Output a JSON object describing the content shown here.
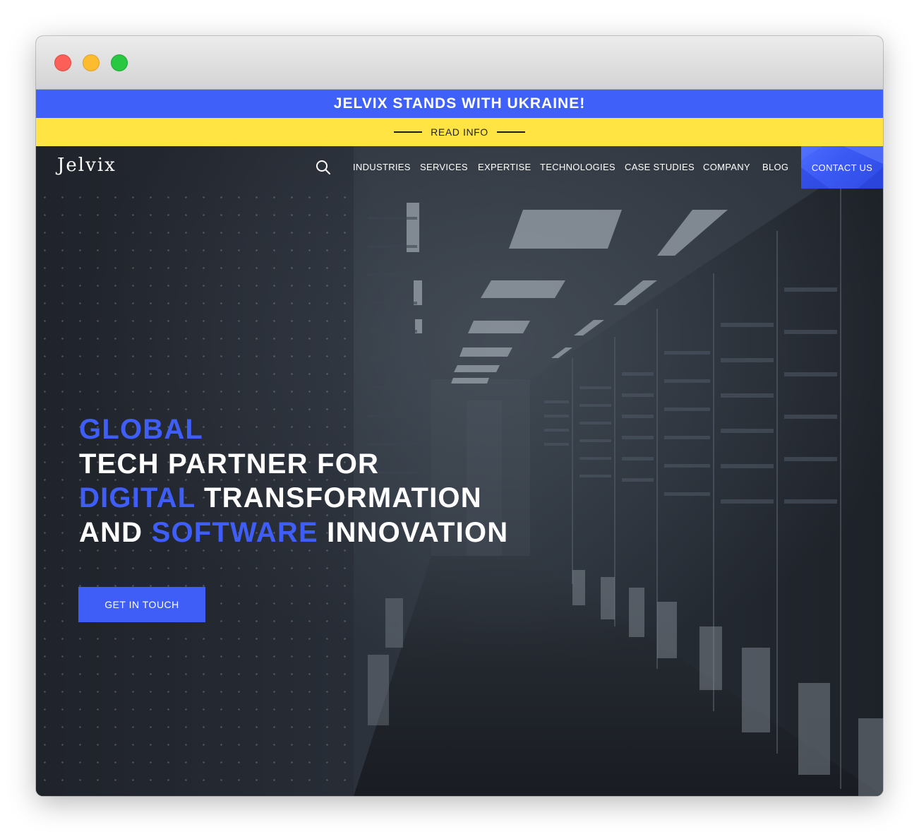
{
  "window": {
    "controls": [
      "close",
      "minimize",
      "maximize"
    ]
  },
  "banner": {
    "title": "JELVIX STANDS WITH UKRAINE!",
    "link": "READ INFO",
    "colors": {
      "blue": "#3f61f9",
      "yellow": "#ffe444"
    }
  },
  "header": {
    "logo": "Jelvix",
    "search_icon": "search-icon",
    "nav": [
      {
        "label": "INDUSTRIES"
      },
      {
        "label": "SERVICES"
      },
      {
        "label": "EXPERTISE"
      },
      {
        "label": "TECHNOLOGIES"
      },
      {
        "label": "CASE STUDIES"
      },
      {
        "label": "COMPANY"
      },
      {
        "label": "BLOG"
      }
    ],
    "contact": "CONTACT US"
  },
  "hero": {
    "line1": {
      "accent": "GLOBAL"
    },
    "line2": {
      "text": "TECH PARTNER FOR"
    },
    "line3": {
      "accent": "DIGITAL",
      "text": " TRANSFORMATION"
    },
    "line4": {
      "text_before": "AND ",
      "accent": "SOFTWARE",
      "text_after": " INNOVATION"
    },
    "cta": "GET IN TOUCH",
    "background": "data-center server room corridor"
  },
  "colors": {
    "accent": "#3f5ef8",
    "hero_background": "#23272f",
    "text": "#ffffff"
  }
}
